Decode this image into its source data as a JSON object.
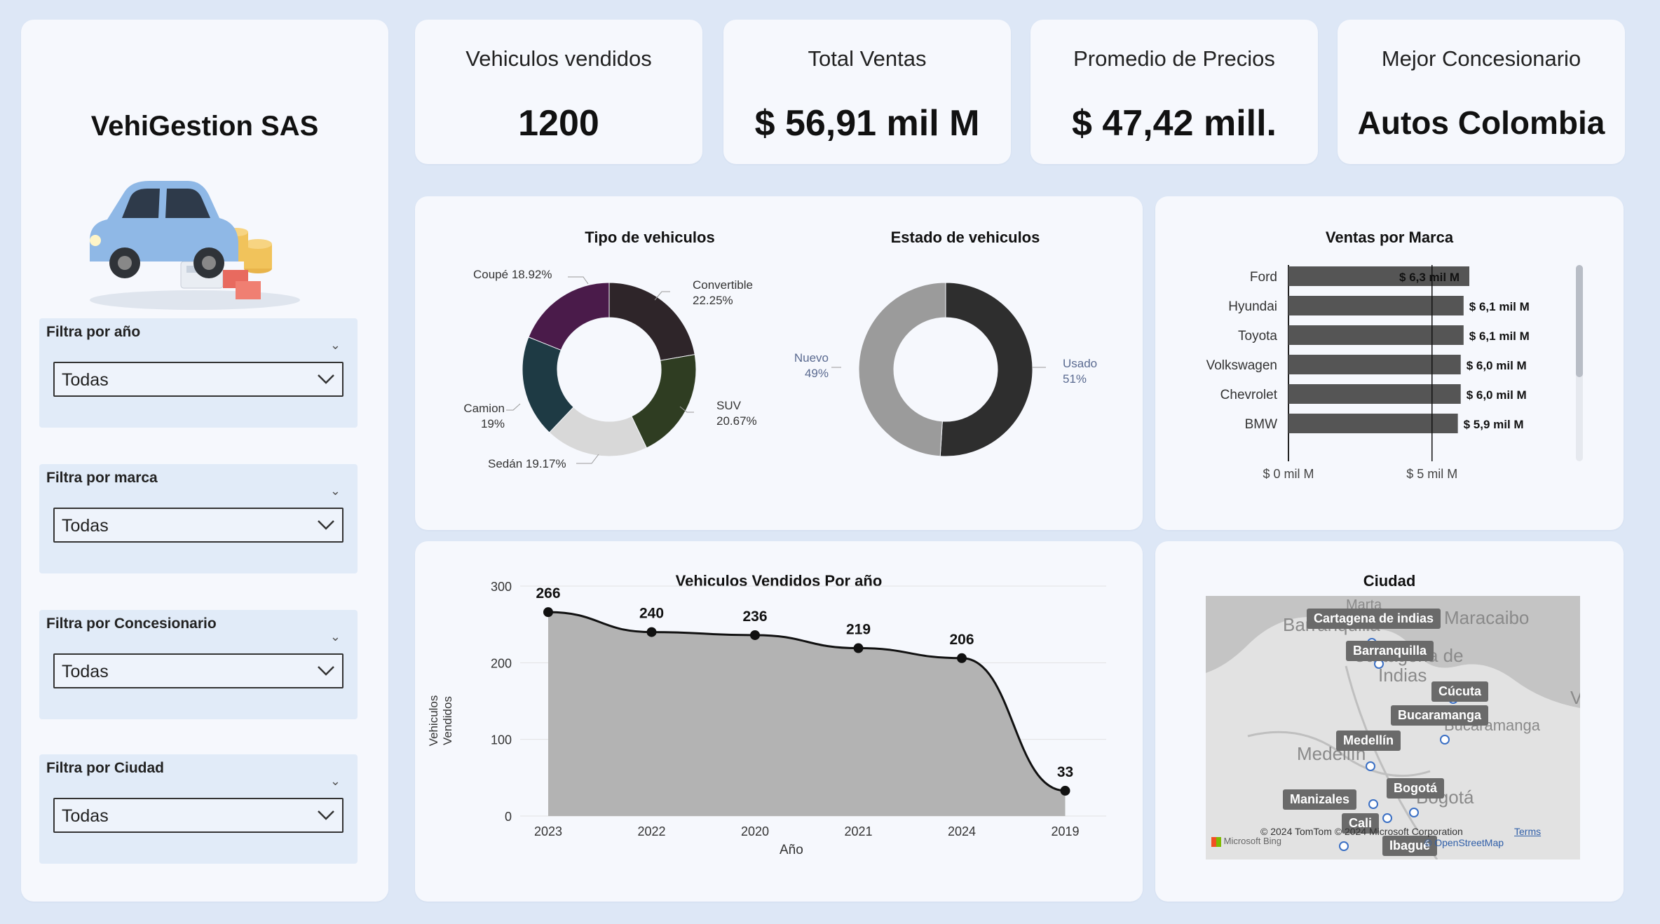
{
  "sidebar": {
    "brand": "VehiGestion SAS",
    "filters": [
      {
        "label": "Filtra por año",
        "value": "Todas"
      },
      {
        "label": "Filtra por marca",
        "value": "Todas"
      },
      {
        "label": "Filtra por Concesionario",
        "value": "Todas"
      },
      {
        "label": "Filtra por Ciudad",
        "value": "Todas"
      }
    ]
  },
  "kpis": [
    {
      "title": "Vehiculos vendidos",
      "value": "1200"
    },
    {
      "title": "Total Ventas",
      "value": "$ 56,91 mil M"
    },
    {
      "title": "Promedio de Precios",
      "value": "$ 47,42 mill."
    },
    {
      "title": "Mejor Concesionario",
      "value": "Autos Colombia"
    }
  ],
  "tipo_chart": {
    "title": "Tipo de vehiculos",
    "labels": [
      {
        "name": "Coupé",
        "pct": "18.92%"
      },
      {
        "name": "Convertible",
        "pct": "22.25%"
      },
      {
        "name": "SUV",
        "pct": "20.67%"
      },
      {
        "name": "Sedán",
        "pct": "19.17%"
      },
      {
        "name": "Camion",
        "pct": "19%"
      }
    ]
  },
  "estado_chart": {
    "title": "Estado de vehiculos",
    "labels": [
      {
        "name": "Nuevo",
        "pct": "49%"
      },
      {
        "name": "Usado",
        "pct": "51%"
      }
    ]
  },
  "marca_chart": {
    "title": "Ventas por Marca",
    "brands": [
      "Ford",
      "Hyundai",
      "Toyota",
      "Volkswagen",
      "Chevrolet",
      "BMW"
    ],
    "value_labels": [
      "$ 6,3 mil M",
      "$ 6,1 mil M",
      "$ 6,1 mil M",
      "$ 6,0 mil M",
      "$ 6,0 mil M",
      "$ 5,9 mil M"
    ],
    "axis_ticks": [
      "$ 0 mil M",
      "$ 5 mil M"
    ]
  },
  "year_chart": {
    "title": "Vehiculos Vendidos Por año",
    "xlabel": "Año",
    "ylabel": "Vehiculos Vendidos",
    "yticks": [
      "300",
      "200",
      "100",
      "0"
    ]
  },
  "city_map": {
    "title": "Ciudad",
    "cities": [
      "Cartagena de indias",
      "Barranquilla",
      "Cúcuta",
      "Bucaramanga",
      "Medellín",
      "Bogotá",
      "Manizales",
      "Cali",
      "Ibagué"
    ],
    "basemap_towns": [
      "Barranquilla",
      "Marta",
      "Maracaibo",
      "Cartagena de",
      "Indias",
      "Bucaramanga",
      "Medellín",
      "Bogotá",
      "V"
    ],
    "attribution": "© 2024 TomTom © 2024 Microsoft Corporation",
    "terms": "Terms",
    "osm": "© OpenStreetMap",
    "bing": "Microsoft Bing"
  },
  "chart_data": [
    {
      "type": "pie",
      "title": "Tipo de vehiculos",
      "categories": [
        "Convertible",
        "SUV",
        "Sedán",
        "Camion",
        "Coupé"
      ],
      "values": [
        22.25,
        20.67,
        19.17,
        19.0,
        18.92
      ],
      "colors": [
        "#2e2529",
        "#2f3d22",
        "#d8d8d8",
        "#1e3a44",
        "#4a1b4a"
      ]
    },
    {
      "type": "pie",
      "title": "Estado de vehiculos",
      "categories": [
        "Usado",
        "Nuevo"
      ],
      "values": [
        51,
        49
      ],
      "colors": [
        "#2e2e2e",
        "#9b9b9b"
      ]
    },
    {
      "type": "bar",
      "title": "Ventas por Marca",
      "categories": [
        "Ford",
        "Hyundai",
        "Toyota",
        "Volkswagen",
        "Chevrolet",
        "BMW"
      ],
      "values": [
        6.3,
        6.1,
        6.1,
        6.0,
        6.0,
        5.9
      ],
      "xlim": [
        0,
        6.3
      ]
    },
    {
      "type": "area",
      "title": "Vehiculos Vendidos Por año",
      "categories": [
        "2023",
        "2022",
        "2020",
        "2021",
        "2024",
        "2019"
      ],
      "values": [
        266,
        240,
        236,
        219,
        206,
        33
      ],
      "xlabel": "Año",
      "ylabel": "Vehiculos Vendidos",
      "ylim": [
        0,
        300
      ]
    }
  ]
}
